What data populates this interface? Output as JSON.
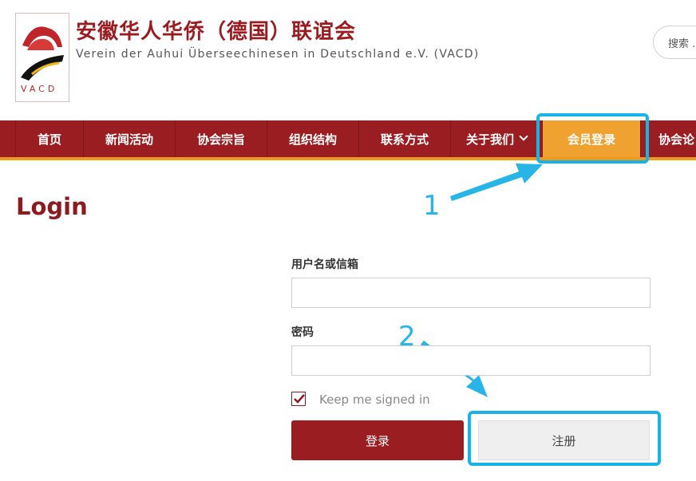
{
  "header": {
    "logo_text": "VACD",
    "title": "安徽华人华侨（德国）联谊会",
    "subtitle": "Verein der Auhui Überseechinesen in Deutschland e.V. (VACD)",
    "search_label": "搜索 ..."
  },
  "nav": {
    "items": [
      {
        "label": "首页"
      },
      {
        "label": "新闻活动"
      },
      {
        "label": "协会宗旨"
      },
      {
        "label": "组织结构"
      },
      {
        "label": "联系方式"
      },
      {
        "label": "关于我们"
      },
      {
        "label": "会员登录",
        "active": true
      },
      {
        "label": "协会论"
      }
    ]
  },
  "login": {
    "title": "Login",
    "username_label": "用户名或信箱",
    "username_value": "",
    "password_label": "密码",
    "password_value": "",
    "remember_label": "Keep me signed in",
    "remember_checked": true,
    "login_button": "登录",
    "register_button": "注册"
  },
  "annotations": {
    "step1": "1",
    "step2": "2",
    "color": "#1ab3e8"
  }
}
